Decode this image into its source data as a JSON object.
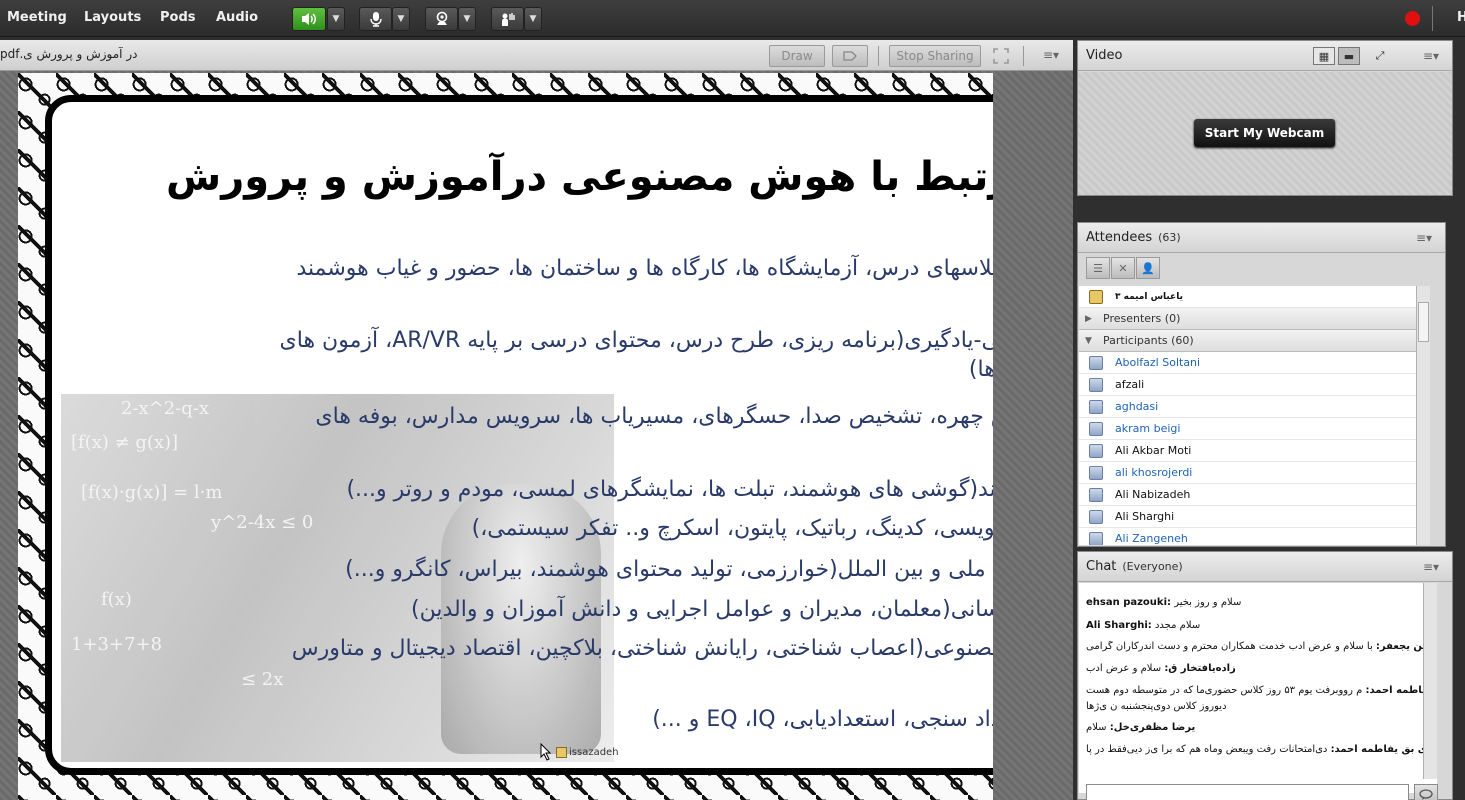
{
  "menubar": {
    "items": [
      "Meeting",
      "Layouts",
      "Pods",
      "Audio"
    ],
    "trailing_label": "H",
    "speaker_icon": "speaker-icon",
    "mic_icon": "microphone-icon",
    "camera_icon": "webcam-icon",
    "hand_icon": "raise-hand-icon",
    "active_color": "#3fae29",
    "record_color": "#e01010"
  },
  "share": {
    "title": "در آموزش و پرورش ی.pdf",
    "draw_label": "Draw",
    "stop_label": "Stop Sharing"
  },
  "slide": {
    "title": "مرتبط با هوش مصنوعی درآموزش و پرورش",
    "lines": [
      "س(کلاسهای درس، آزمایشگاه ها، کارگاه ها و ساختمان ها، حضور و غیاب هوشمند",
      "د دهی-یادگیری(برنامه ریزی، طرح درس، محتوای درسی بر پایه AR/VR، آزمون های",
      "جت ها)",
      "خیص چهره، تشخیص صدا، حسگرهای، مسیریاب ها، سرویس مدارس، بوفه های",
      "وشمند(گوشی های هوشمند، تبلت ها، نمایشگرهای لمسی، مودم و روتر و...)",
      "امه نویسی، کدینگ، رباتیک، پایتون، اسکرچ و.. تفکر سیستمی،)",
      "دهای ملی و بین الملل(خوارزمی، تولید محتوای هوشمند، بیراس، کانگرو و...)",
      "ی انسانی(معلمان، مدیران و عوامل اجرایی و دانش آموزان و والدین)",
      "س مصنوعی(اعصاب شناختی، رایانش شناختی، بلاکچین، اقتصاد دیجیتال و متاورس",
      "ستعداد سنجی، استعدادیابی، EQ ،IQ و ...)"
    ],
    "photo_formulas": [
      "2-x^2-q-x",
      "[f(x) ≠ g(x)]",
      "[f(x)·g(x)] = l·m",
      "y^2-4x ≤ 0",
      "f(x)",
      "1+3+7+8",
      "≤ 2x"
    ],
    "presenter_tag": "issazadeh"
  },
  "video": {
    "title": "Video",
    "webcam_label": "Start My Webcam"
  },
  "attendees": {
    "title": "Attendees",
    "count": "(63)",
    "host_row": "یاعباس امیمه ۳",
    "presenters_label": "Presenters (0)",
    "participants_label": "Participants (60)",
    "participants": [
      {
        "name": "Abolfazl Soltani",
        "blue": true
      },
      {
        "name": "afzali",
        "blue": false
      },
      {
        "name": "aghdasi",
        "blue": true
      },
      {
        "name": "akram beigi",
        "blue": true
      },
      {
        "name": "Ali Akbar Moti",
        "blue": false
      },
      {
        "name": "ali khosrojerdi",
        "blue": true
      },
      {
        "name": "Ali Nabizadeh",
        "blue": false
      },
      {
        "name": "Ali Sharghi",
        "blue": false
      },
      {
        "name": "Ali Zangeneh",
        "blue": true
      }
    ]
  },
  "chat": {
    "title": "Chat",
    "scope": "(Everyone)",
    "messages": [
      {
        "who": "ehsan pazouki:",
        "text": " سلام و روز بخیر"
      },
      {
        "who": "Ali Sharghi:",
        "text": " سلام مجدد"
      },
      {
        "who": "محسن یجعفر:",
        "text": " با سلام و عرض ادب خدمت همکاران محترم و دست اندرکاران گرامی"
      },
      {
        "who": "زاده‌یافتخار ‌ق:",
        "text": " سلام و عرض ادب"
      },
      {
        "who": "بازی ‌بق یفاطمه احمد:",
        "text": " م رووبرفت یوم ۵۳ روز کلاس حضوری‌ما که در متوسطه دوم هست"
      },
      {
        "who": "",
        "text": "دیوروز کلاس دوی‌پنجشنبه ن ی‌ژ‌ها"
      },
      {
        "who": "یرضا مظفری‌خل:",
        "text": " سلام"
      },
      {
        "who": "بازی ‌بق یفاطمه احمد:",
        "text": " دی‌امتحانات رفت ویبعض وماه هم که برا ی‌ز دیی‌فقط در پا"
      }
    ]
  }
}
